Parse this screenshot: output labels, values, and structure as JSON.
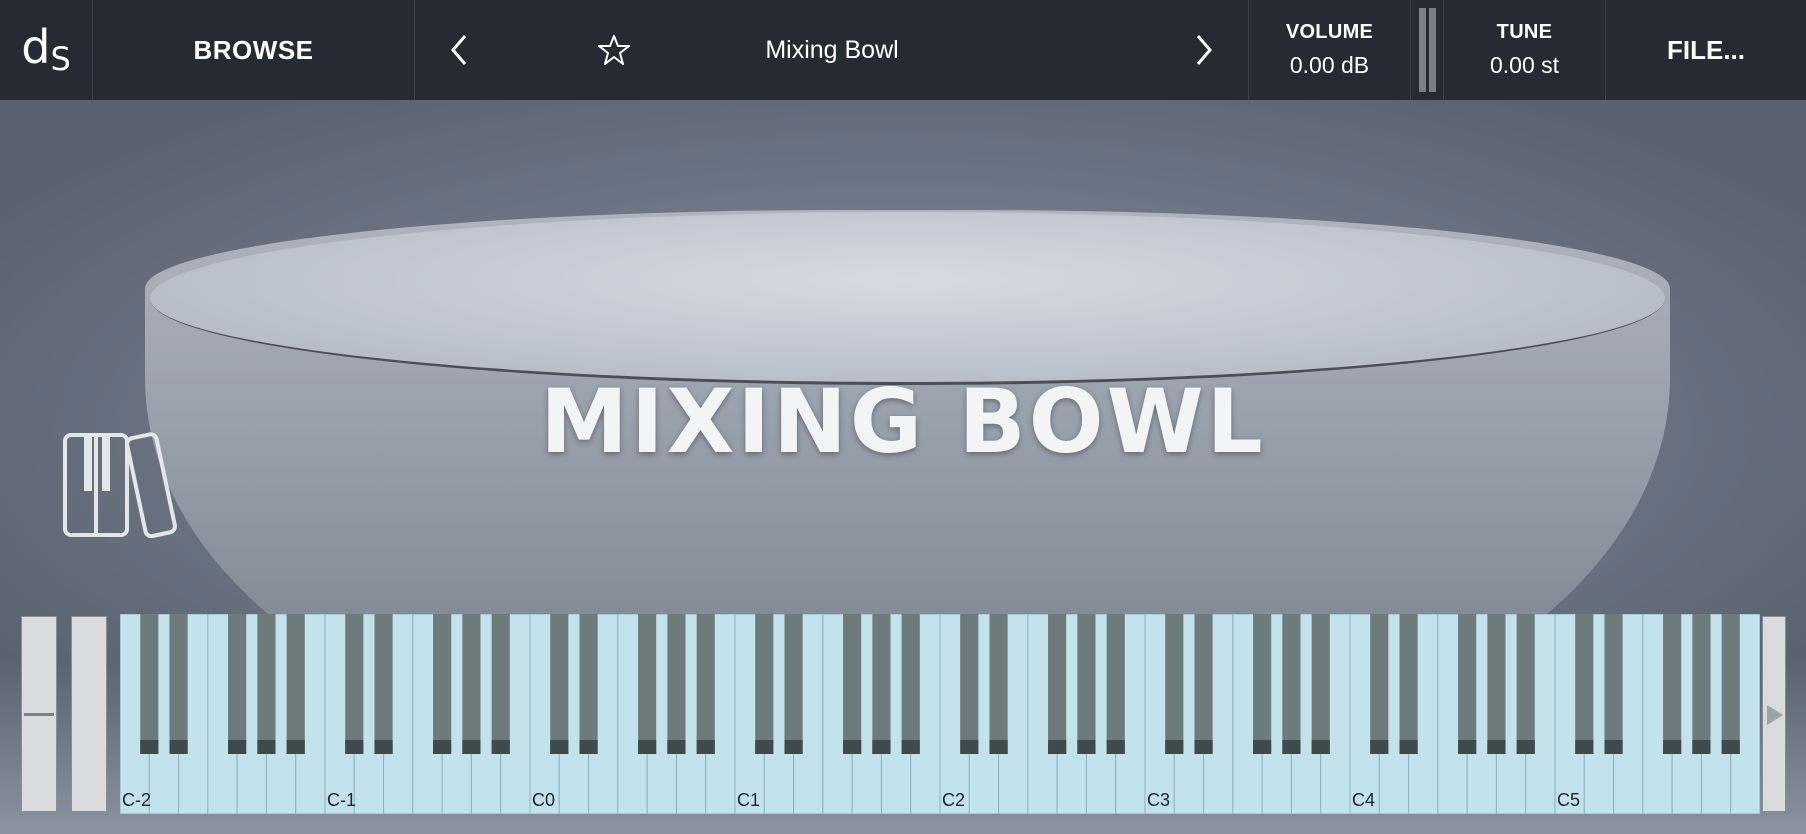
{
  "logo": {
    "text_d": "d",
    "text_s": "S"
  },
  "topbar": {
    "browse_label": "BROWSE",
    "preset_name": "Mixing Bowl",
    "volume": {
      "label": "VOLUME",
      "value": "0.00 dB"
    },
    "tune": {
      "label": "TUNE",
      "value": "0.00 st"
    },
    "file_label": "FILE..."
  },
  "artwork": {
    "title": "MIXING BOWL"
  },
  "keyboard": {
    "octave_labels": [
      "C-2",
      "C-1",
      "C0",
      "C1",
      "C2",
      "C3",
      "C4",
      "C5"
    ],
    "white_key_color": "#c2e3ec",
    "black_key_color": "#6e7b7d"
  },
  "icons": {
    "prev": "chevron-left-icon",
    "next": "chevron-right-icon",
    "favorite": "star-icon",
    "library": "piano-library-icon",
    "scroll": "triangle-right-icon"
  }
}
